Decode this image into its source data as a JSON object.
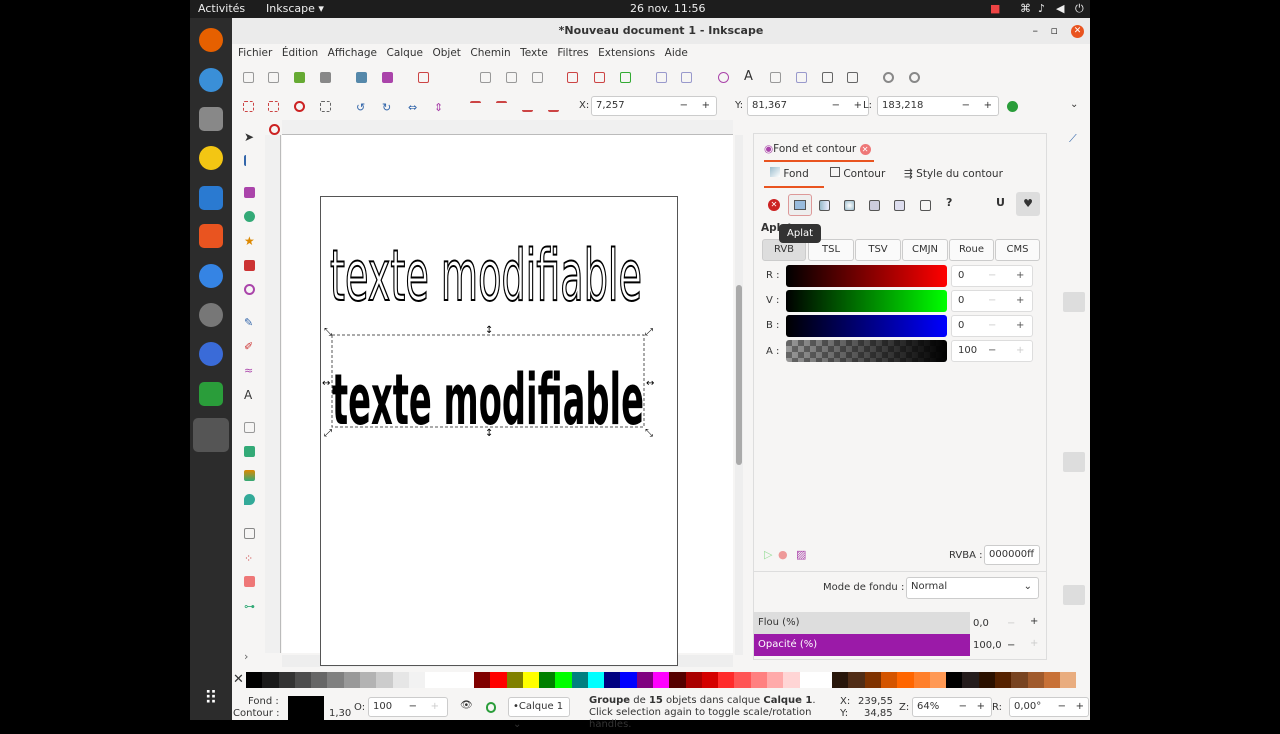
{
  "topbar": {
    "activities": "Activités",
    "app": "Inkscape ▾",
    "clock": "26 nov.  11:56"
  },
  "window": {
    "title": "*Nouveau document 1 - Inkscape"
  },
  "menu": [
    "Fichier",
    "Édition",
    "Affichage",
    "Calque",
    "Objet",
    "Chemin",
    "Texte",
    "Filtres",
    "Extensions",
    "Aide"
  ],
  "toolbar": {
    "x_label": "X:",
    "x_value": "7,257",
    "y_label": "Y:",
    "y_value": "81,367",
    "w_label": "L:",
    "w_value": "183,218"
  },
  "canvas": {
    "text1": "texte modifiable",
    "text2": "texte modifiable"
  },
  "panel": {
    "tab_title": "Fond et contour",
    "tabs": [
      "Fond",
      "Contour",
      "Style du contour"
    ],
    "section": "Aplat",
    "tooltip": "Aplat",
    "modes": [
      "RVB",
      "TSL",
      "TSV",
      "CMJN",
      "Roue",
      "CMS"
    ],
    "channels": [
      {
        "label": "R :",
        "value": "0"
      },
      {
        "label": "V :",
        "value": "0"
      },
      {
        "label": "B :",
        "value": "0"
      },
      {
        "label": "A :",
        "value": "100"
      }
    ],
    "rgba_label": "RVBA :",
    "rgba_value": "000000ff",
    "blend_label": "Mode de fondu :",
    "blend_value": "Normal",
    "blur_label": "Flou (%)",
    "blur_value": "0,0",
    "opacity_label": "Opacité (%)",
    "opacity_value": "100,0",
    "accent": "#9b1aa8"
  },
  "status": {
    "fill_label": "Fond :",
    "stroke_label": "Contour :",
    "stroke_width": "1,30",
    "o_label": "O:",
    "o_value": "100",
    "layer": "•Calque 1",
    "message_pre": "Groupe",
    "message_mid1": " de ",
    "count": "15",
    "message_mid2": " objets dans calque ",
    "layer_bold": "Calque 1",
    "message_post": ". Click selection again to toggle scale/rotation handles.",
    "x_label": "X:",
    "x_value": "239,55",
    "y_label": "Y:",
    "y_value": "34,85",
    "z_label": "Z:",
    "zoom": "64%",
    "r_label": "R:",
    "rotation": "0,00°"
  }
}
